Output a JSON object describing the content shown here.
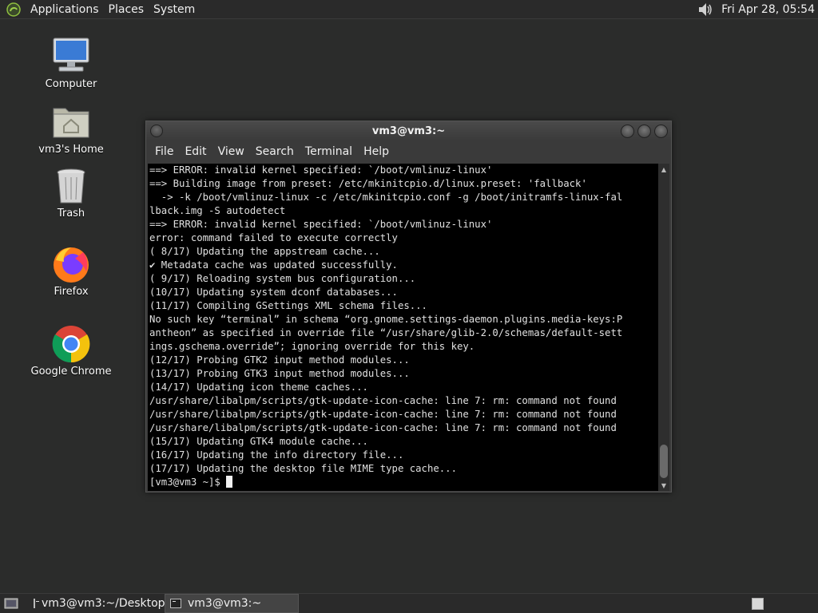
{
  "top_panel": {
    "menus": [
      "Applications",
      "Places",
      "System"
    ],
    "clock": "Fri Apr 28, 05:54",
    "icons": {
      "logo": "distro-logo-icon",
      "volume": "volume-icon"
    }
  },
  "desktop_icons": [
    {
      "label": "Computer",
      "icon": "computer-icon"
    },
    {
      "label": "vm3's Home",
      "icon": "home-folder-icon"
    },
    {
      "label": "Trash",
      "icon": "trash-icon"
    },
    {
      "label": "Firefox",
      "icon": "firefox-icon"
    },
    {
      "label": "Google Chrome",
      "icon": "chrome-icon"
    }
  ],
  "terminal": {
    "title": "vm3@vm3:~",
    "menus": [
      "File",
      "Edit",
      "View",
      "Search",
      "Terminal",
      "Help"
    ],
    "lines": [
      "==> ERROR: invalid kernel specified: `/boot/vmlinuz-linux'",
      "==> Building image from preset: /etc/mkinitcpio.d/linux.preset: 'fallback'",
      "  -> -k /boot/vmlinuz-linux -c /etc/mkinitcpio.conf -g /boot/initramfs-linux-fal",
      "lback.img -S autodetect",
      "==> ERROR: invalid kernel specified: `/boot/vmlinuz-linux'",
      "error: command failed to execute correctly",
      "( 8/17) Updating the appstream cache...",
      "✔ Metadata cache was updated successfully.",
      "( 9/17) Reloading system bus configuration...",
      "(10/17) Updating system dconf databases...",
      "(11/17) Compiling GSettings XML schema files...",
      "No such key “terminal” in schema “org.gnome.settings-daemon.plugins.media-keys:P",
      "antheon” as specified in override file “/usr/share/glib-2.0/schemas/default-sett",
      "ings.gschema.override”; ignoring override for this key.",
      "(12/17) Probing GTK2 input method modules...",
      "(13/17) Probing GTK3 input method modules...",
      "(14/17) Updating icon theme caches...",
      "/usr/share/libalpm/scripts/gtk-update-icon-cache: line 7: rm: command not found",
      "/usr/share/libalpm/scripts/gtk-update-icon-cache: line 7: rm: command not found",
      "/usr/share/libalpm/scripts/gtk-update-icon-cache: line 7: rm: command not found",
      "(15/17) Updating GTK4 module cache...",
      "(16/17) Updating the info directory file...",
      "(17/17) Updating the desktop file MIME type cache..."
    ],
    "prompt": "[vm3@vm3 ~]$ "
  },
  "taskbar": {
    "items": [
      {
        "label": "vm3@vm3:~/Desktop",
        "active": false
      },
      {
        "label": "vm3@vm3:~",
        "active": true
      }
    ]
  }
}
